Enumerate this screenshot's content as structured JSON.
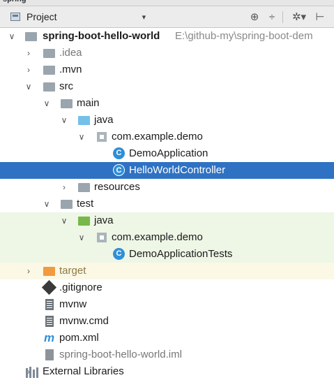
{
  "top_strip": {
    "tabs": [
      "spring",
      "",
      ""
    ]
  },
  "header": {
    "title": "Project",
    "dropdown_glyph": "▾",
    "icons": [
      "project-icon",
      "locate-icon",
      "collapse-all-icon",
      "settings-icon",
      "hide-panel-icon"
    ],
    "tool_glyphs": {
      "locate": "⊕",
      "collapse": "÷",
      "settings": "✲▾",
      "hide": "⊢"
    }
  },
  "tree": {
    "glyphs": {
      "expanded": "∨",
      "collapsed": "›",
      "class": "C",
      "maven": "m"
    },
    "nodes": [
      {
        "label": "spring-boot-hello-world",
        "path": "E:\\github-my\\spring-boot-dem",
        "icon": "project-folder-icon",
        "expanded": true
      },
      {
        "label": ".idea",
        "icon": "folder-icon",
        "expanded": false
      },
      {
        "label": ".mvn",
        "icon": "folder-icon",
        "expanded": false
      },
      {
        "label": "src",
        "icon": "folder-icon",
        "expanded": true
      },
      {
        "label": "main",
        "icon": "folder-icon",
        "expanded": true
      },
      {
        "label": "java",
        "icon": "source-folder-icon",
        "expanded": true
      },
      {
        "label": "com.example.demo",
        "icon": "package-icon",
        "expanded": true
      },
      {
        "label": "DemoApplication",
        "icon": "spring-boot-class-icon"
      },
      {
        "label": "HelloWorldController",
        "icon": "class-icon",
        "selected": true
      },
      {
        "label": "resources",
        "icon": "resources-folder-icon",
        "expanded": false
      },
      {
        "label": "test",
        "icon": "folder-icon",
        "expanded": true
      },
      {
        "label": "java",
        "icon": "test-source-folder-icon",
        "expanded": true
      },
      {
        "label": "com.example.demo",
        "icon": "package-icon",
        "expanded": true
      },
      {
        "label": "DemoApplicationTests",
        "icon": "test-class-icon"
      },
      {
        "label": "target",
        "icon": "excluded-folder-icon",
        "expanded": false
      },
      {
        "label": ".gitignore",
        "icon": "git-file-icon"
      },
      {
        "label": "mvnw",
        "icon": "text-file-icon"
      },
      {
        "label": "mvnw.cmd",
        "icon": "text-file-icon"
      },
      {
        "label": "pom.xml",
        "icon": "maven-icon"
      },
      {
        "label": "spring-boot-hello-world.iml",
        "icon": "iml-file-icon"
      },
      {
        "label": "External Libraries",
        "icon": "libraries-icon",
        "expanded": false
      }
    ]
  },
  "colors": {
    "selection": "#2f72c4",
    "test_highlight": "#eef6e6",
    "excluded_highlight": "#fbf8e6",
    "source_folder": "#74c0e8",
    "test_folder": "#77b84a",
    "excluded_folder": "#f19a3e",
    "class_icon": "#2f8fd8"
  }
}
